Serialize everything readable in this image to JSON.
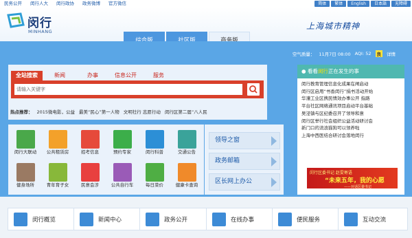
{
  "topbar": {
    "links": [
      "民务公开",
      "闵行人大",
      "闵行政协",
      "政务微博",
      "官方微信"
    ],
    "buttons": [
      "简体",
      "繁体",
      "English",
      "日本語",
      "无障碍"
    ]
  },
  "header": {
    "logo_text": "闵行",
    "logo_sub": "MINHANG",
    "slogan": "上海城市精神",
    "tabs": [
      "综合版",
      "社区版",
      "商务版"
    ]
  },
  "air": {
    "label": "空气质量：",
    "date": "11月7日 08:00",
    "aqi_label": "AQI: 52",
    "level": "良",
    "detail": "详情"
  },
  "search": {
    "tabs": [
      "全站搜索",
      "新闻",
      "办事",
      "信息公开",
      "服务"
    ],
    "placeholder": "请输入关键字",
    "hot_label": "热点推荐：",
    "hot_items": [
      "2015微电影，公益",
      "最美“民心”第一人物",
      "文明社行 志愿行动",
      "闵行区第二届“八人民"
    ]
  },
  "tiles": [
    {
      "label": "闵行大联动",
      "color": "#4aa84a"
    },
    {
      "label": "公共租赁房",
      "color": "#f3a12a"
    },
    {
      "label": "招考信息",
      "color": "#e64a3b"
    },
    {
      "label": "预约专家",
      "color": "#3cae4a"
    },
    {
      "label": "闵行科普",
      "color": "#2c8fd6"
    },
    {
      "label": "交通公告",
      "color": "#3aa39a"
    },
    {
      "label": "健身场所",
      "color": "#9a7a63"
    },
    {
      "label": "青年育子女",
      "color": "#88b83a"
    },
    {
      "label": "民意会涉",
      "color": "#e8403f"
    },
    {
      "label": "公共自行车",
      "color": "#9a5bb7"
    },
    {
      "label": "每日菜价",
      "color": "#4fae44"
    },
    {
      "label": "健康卡查询",
      "color": "#f08a2a"
    }
  ],
  "side_links": [
    "领导之窗",
    "政务邮箱",
    "区长网上办公"
  ],
  "news": {
    "header_prefix": "看看",
    "header_highlight": "闵行",
    "header_suffix": "正在发生的事",
    "items": [
      "闵行教育管理信息化成果在闸启动",
      "闵行区启用“书香闵行”捐书活动开始",
      "华漕工业区携民情效办事公开 指路",
      "平台社区网络通讯项目启动平台基础",
      "吴泾镇与区纪委召开了领导和意",
      "闵行区举行社会组织公益活动研讨会",
      "新门口的流浪猫狗可以领养啦",
      "上海中西医结合研讨会落地闵行"
    ],
    "banner_top": "闵行区委书记 赵雯寄语",
    "banner_main": "“未来五年，我的心愿",
    "banner_sub": "——对话区委书记"
  },
  "bottom_nav": [
    "闵行概览",
    "新闻中心",
    "政务公开",
    "在线办事",
    "便民服务",
    "互动交流"
  ]
}
